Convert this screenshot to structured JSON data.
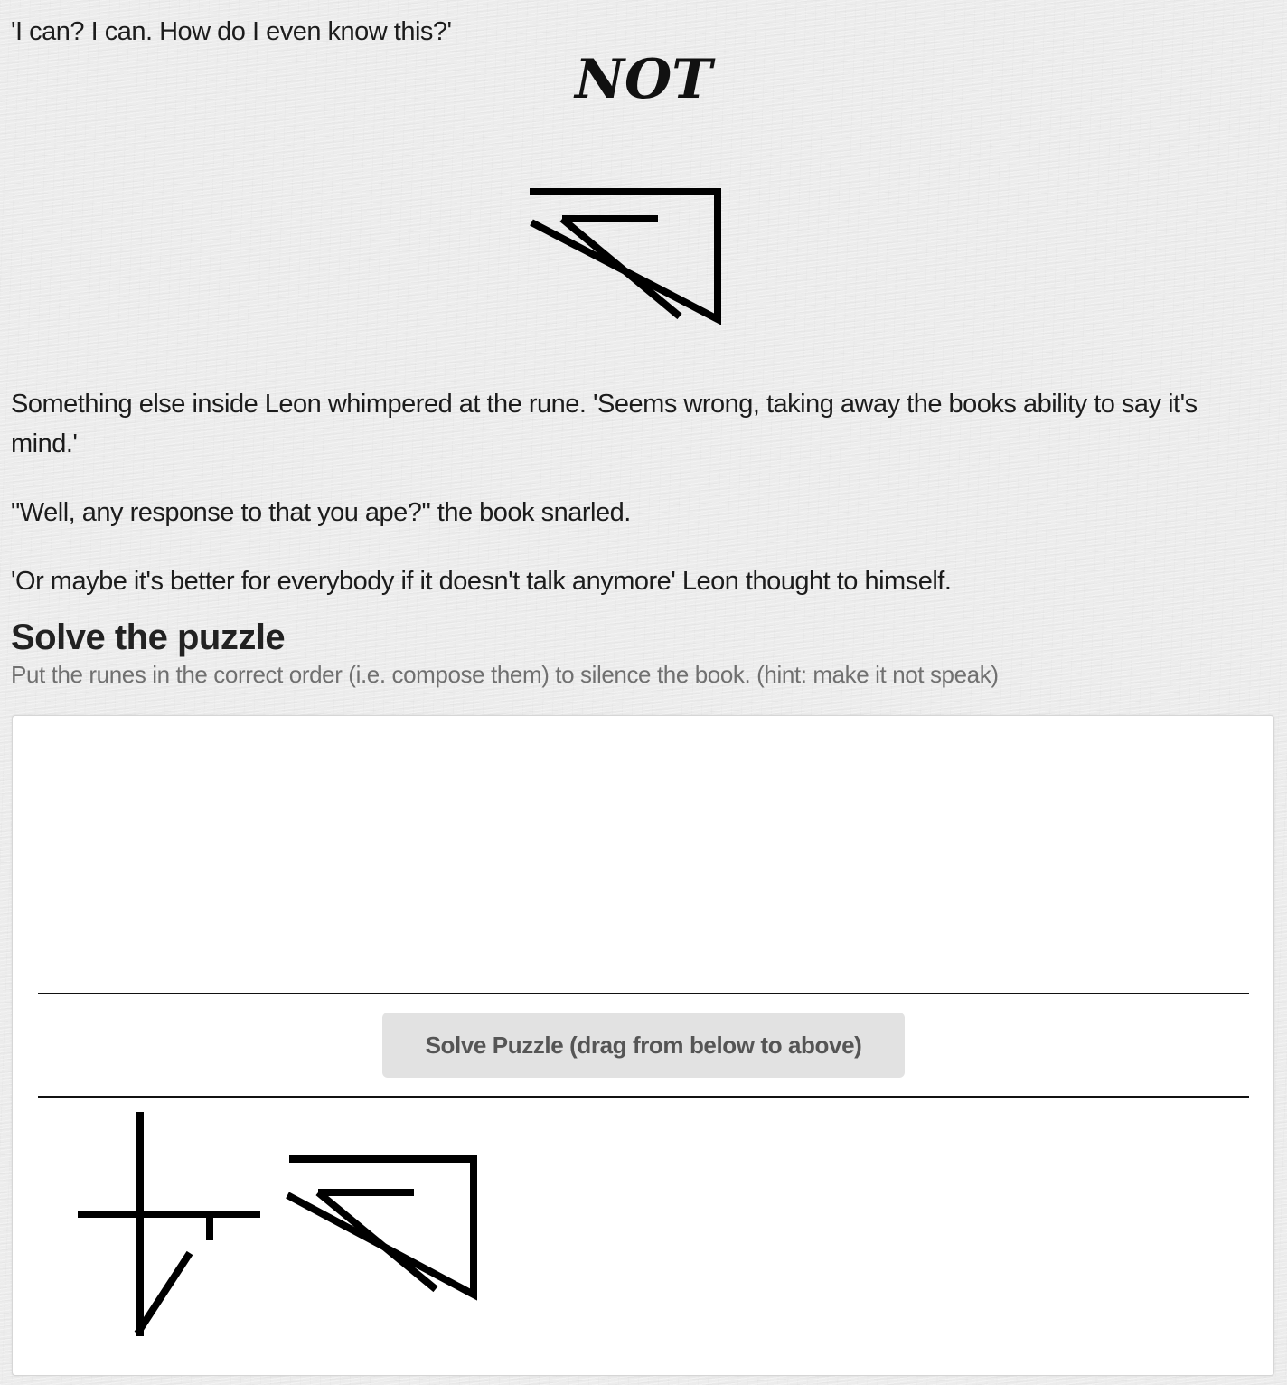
{
  "story": {
    "intro_line": "'I can? I can. How do I even know this?'",
    "rune_title": "NOT",
    "rune_icon": "not-rune-icon",
    "paragraphs": [
      "Something else inside Leon whimpered at the rune. 'Seems wrong, taking away the books ability to say it's mind.'",
      "\"Well, any response to that you ape?\" the book snarled.",
      "'Or maybe it's better for everybody if it doesn't talk anymore' Leon thought to himself."
    ]
  },
  "puzzle": {
    "heading": "Solve the puzzle",
    "instructions": "Put the runes in the correct order (i.e. compose them) to silence the book. (hint: make it not speak)",
    "solve_button_label": "Solve Puzzle (drag from below to above)",
    "tray_runes": [
      {
        "icon": "speak-rune-icon"
      },
      {
        "icon": "not-rune-icon"
      }
    ]
  },
  "colors": {
    "background": "#ececec",
    "panel": "#ffffff",
    "button": "#e2e2e2",
    "button_text": "#555555",
    "instructions_text": "#707070",
    "rune_stroke": "#000000"
  }
}
